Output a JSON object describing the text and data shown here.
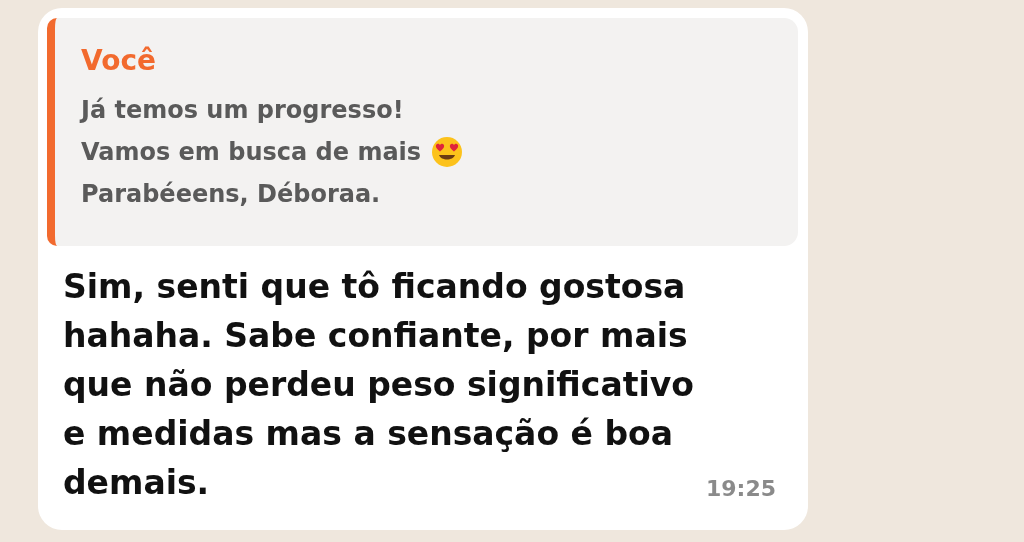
{
  "message": {
    "quote": {
      "author": "Você",
      "lines": [
        {
          "kind": "plain",
          "text": "Já temos um progresso!"
        },
        {
          "kind": "with_emoji",
          "text": "Vamos em busca de mais"
        },
        {
          "kind": "plain",
          "text": "Parabéeens, Déboraa."
        }
      ]
    },
    "text": "Sim, senti que tô ficando gostosa hahaha. Sabe confiante, por mais que não perdeu peso significativo e medidas mas a sensação é boa demais.",
    "time": "19:25"
  }
}
